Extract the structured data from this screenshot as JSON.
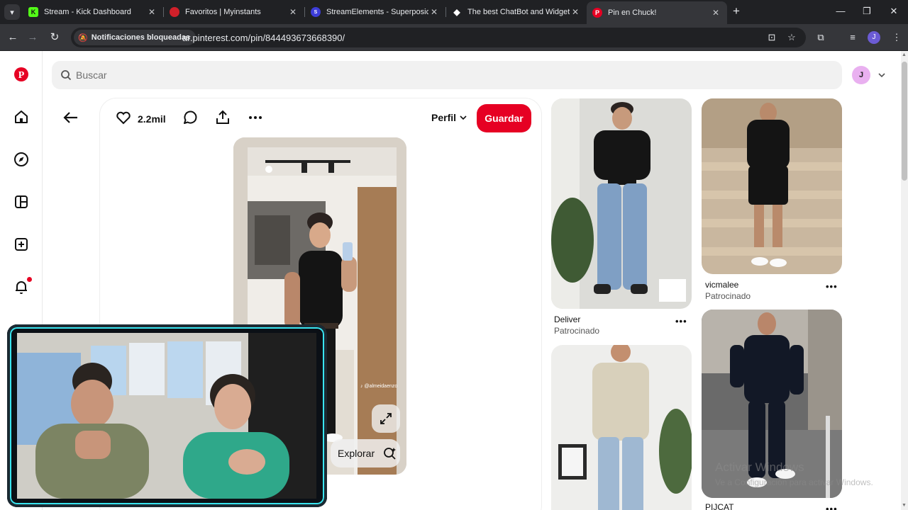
{
  "browser": {
    "tabs": [
      {
        "title": "Stream - Kick Dashboard",
        "favicon": "K",
        "favicon_color": "#53fc18",
        "active": false
      },
      {
        "title": "Favoritos | Myinstants",
        "favicon": "●",
        "favicon_color": "#d0202a",
        "active": false
      },
      {
        "title": "StreamElements - Superposicio",
        "favicon": "SE",
        "favicon_color": "#3d3dd9",
        "active": false
      },
      {
        "title": "The best ChatBot and Widgets",
        "favicon": "◆",
        "favicon_color": "#ffffff",
        "active": false
      },
      {
        "title": "Pin en Chuck!",
        "favicon": "P",
        "favicon_color": "#e60023",
        "active": true
      }
    ],
    "omnibox": {
      "chip_label": "Notificaciones bloqueadas",
      "url": "ar.pinterest.com/pin/844493673668390/"
    },
    "profile_initial": "J"
  },
  "pinterest": {
    "search_placeholder": "Buscar",
    "user_initial": "J",
    "pin": {
      "likes": "2.2mil",
      "profile_label": "Perfil",
      "save_label": "Guardar",
      "watermark": "♪ @almeidaenzo",
      "explore_label": "Explorar"
    },
    "feed": [
      {
        "title": "Deliver",
        "subtitle": "Patrocinado"
      },
      {
        "title": "vicmalee",
        "subtitle": "Patrocinado"
      },
      {
        "title": "",
        "subtitle": ""
      },
      {
        "title": "PIJCAT",
        "subtitle": ""
      }
    ],
    "accent_color": "#e60023"
  },
  "windows_watermark": {
    "line1": "Activar Windows",
    "line2": "Ve a Configuración para activar Windows."
  }
}
